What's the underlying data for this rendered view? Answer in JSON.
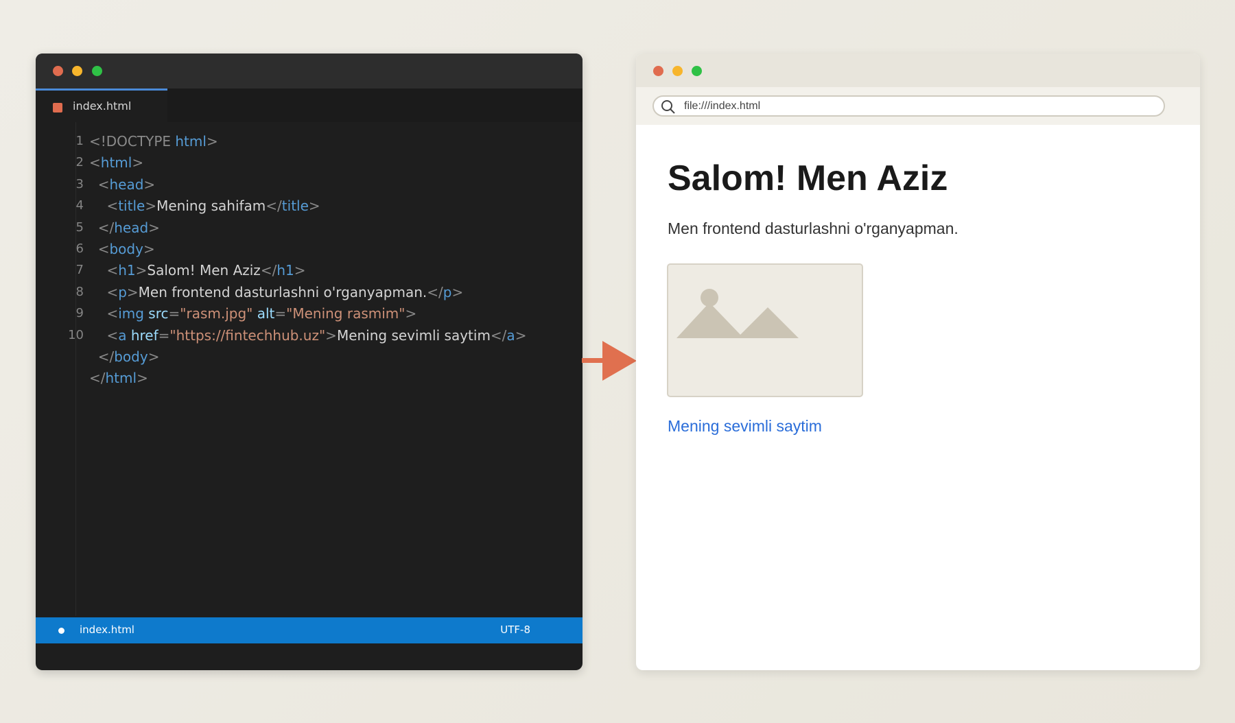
{
  "editor": {
    "tab_label": "index.html",
    "lines": [
      {
        "n": "1",
        "tokens": [
          [
            "pun",
            "<!DOCTYPE "
          ],
          [
            "tag",
            "html"
          ],
          [
            "pun",
            ">"
          ]
        ]
      },
      {
        "n": "2",
        "tokens": [
          [
            "pun",
            "<"
          ],
          [
            "tag",
            "html"
          ],
          [
            "pun",
            ">"
          ]
        ]
      },
      {
        "n": "3",
        "tokens": [
          [
            "txt",
            "  "
          ],
          [
            "pun",
            "<"
          ],
          [
            "tag",
            "head"
          ],
          [
            "pun",
            ">"
          ]
        ]
      },
      {
        "n": "4",
        "tokens": [
          [
            "txt",
            "    "
          ],
          [
            "pun",
            "<"
          ],
          [
            "tag",
            "title"
          ],
          [
            "pun",
            ">"
          ],
          [
            "txt",
            "Mening sahifam"
          ],
          [
            "pun",
            "</"
          ],
          [
            "tag",
            "title"
          ],
          [
            "pun",
            ">"
          ]
        ]
      },
      {
        "n": "5",
        "tokens": [
          [
            "txt",
            "  "
          ],
          [
            "pun",
            "</"
          ],
          [
            "tag",
            "head"
          ],
          [
            "pun",
            ">"
          ]
        ]
      },
      {
        "n": "6",
        "tokens": [
          [
            "txt",
            "  "
          ],
          [
            "pun",
            "<"
          ],
          [
            "tag",
            "body"
          ],
          [
            "pun",
            ">"
          ]
        ]
      },
      {
        "n": "7",
        "tokens": [
          [
            "txt",
            "    "
          ],
          [
            "pun",
            "<"
          ],
          [
            "tag",
            "h1"
          ],
          [
            "pun",
            ">"
          ],
          [
            "txt",
            "Salom! Men Aziz"
          ],
          [
            "pun",
            "</"
          ],
          [
            "tag",
            "h1"
          ],
          [
            "pun",
            ">"
          ]
        ]
      },
      {
        "n": "8",
        "tokens": [
          [
            "txt",
            "    "
          ],
          [
            "pun",
            "<"
          ],
          [
            "tag",
            "p"
          ],
          [
            "pun",
            ">"
          ],
          [
            "txt",
            "Men frontend dasturlashni o'rganyapman."
          ],
          [
            "pun",
            "</"
          ],
          [
            "tag",
            "p"
          ],
          [
            "pun",
            ">"
          ]
        ]
      },
      {
        "n": "9",
        "tokens": [
          [
            "txt",
            "    "
          ],
          [
            "pun",
            "<"
          ],
          [
            "tag",
            "img "
          ],
          [
            "attr",
            "src"
          ],
          [
            "pun",
            "="
          ],
          [
            "str",
            "\"rasm.jpg\""
          ],
          [
            "txt",
            " "
          ],
          [
            "attr",
            "alt"
          ],
          [
            "pun",
            "="
          ],
          [
            "str",
            "\"Mening rasmim\""
          ],
          [
            "pun",
            ">"
          ]
        ]
      },
      {
        "n": "10",
        "tokens": [
          [
            "txt",
            "    "
          ],
          [
            "pun",
            "<"
          ],
          [
            "tag",
            "a "
          ],
          [
            "attr",
            "href"
          ],
          [
            "pun",
            "="
          ],
          [
            "str",
            "\"https://fintechhub.uz\""
          ],
          [
            "pun",
            ">"
          ],
          [
            "txt",
            "Mening sevimli saytim"
          ],
          [
            "pun",
            "</"
          ],
          [
            "tag",
            "a"
          ],
          [
            "pun",
            ">"
          ]
        ]
      },
      {
        "n": "",
        "tokens": [
          [
            "txt",
            "  "
          ],
          [
            "pun",
            "</"
          ],
          [
            "tag",
            "body"
          ],
          [
            "pun",
            ">"
          ]
        ]
      },
      {
        "n": "",
        "tokens": [
          [
            "pun",
            "</"
          ],
          [
            "tag",
            "html"
          ],
          [
            "pun",
            ">"
          ]
        ]
      }
    ],
    "status": {
      "file": "index.html",
      "encoding": "UTF-8"
    }
  },
  "browser": {
    "url": "file:///index.html",
    "heading": "Salom! Men Aziz",
    "paragraph": "Men frontend dasturlashni o'rganyapman.",
    "link_text": "Mening sevimli saytim"
  },
  "colors": {
    "accent_arrow": "#e0704f",
    "link": "#2a6dd9",
    "status_bar": "#0e7acc"
  }
}
